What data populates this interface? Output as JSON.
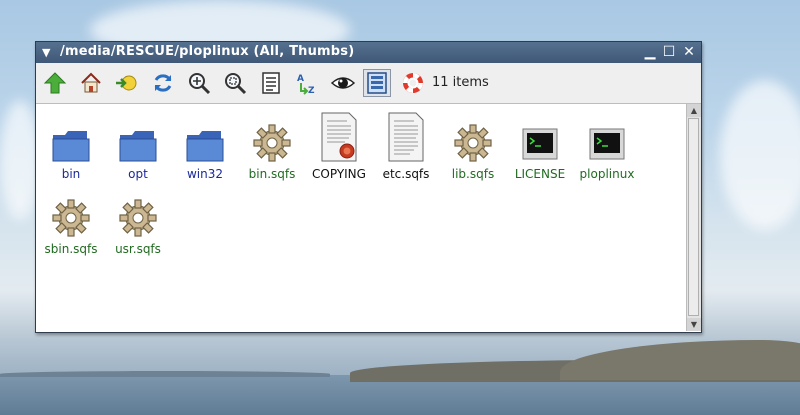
{
  "window": {
    "title": "/media/RESCUE/ploplinux (All, Thumbs)",
    "menu_glyph": "▼",
    "minimize_glyph": "▁",
    "maximize_glyph": "☐",
    "close_glyph": "✕"
  },
  "toolbar": {
    "buttons": [
      {
        "name": "up-arrow-icon"
      },
      {
        "name": "home-icon"
      },
      {
        "name": "go-to-directory-icon"
      },
      {
        "name": "refresh-icon"
      },
      {
        "name": "zoom-in-icon"
      },
      {
        "name": "zoom-fit-icon"
      },
      {
        "name": "details-view-icon"
      },
      {
        "name": "sort-az-icon"
      },
      {
        "name": "show-hidden-icon"
      },
      {
        "name": "thumbnails-view-icon"
      },
      {
        "name": "help-icon"
      }
    ],
    "item_count": "11 items"
  },
  "files": [
    {
      "label": "bin",
      "kind": "dir"
    },
    {
      "label": "opt",
      "kind": "dir"
    },
    {
      "label": "win32",
      "kind": "dir"
    },
    {
      "label": "bin.sqfs",
      "kind": "exec"
    },
    {
      "label": "COPYING",
      "kind": "doc-seal"
    },
    {
      "label": "etc.sqfs",
      "kind": "doc"
    },
    {
      "label": "lib.sqfs",
      "kind": "exec"
    },
    {
      "label": "LICENSE",
      "kind": "terminal"
    },
    {
      "label": "ploplinux",
      "kind": "terminal"
    },
    {
      "label": "sbin.sqfs",
      "kind": "exec"
    },
    {
      "label": "usr.sqfs",
      "kind": "exec"
    }
  ],
  "colors": {
    "titlebar": "#4a6484",
    "directory_label": "#1a2a9a",
    "executable_label": "#216a21"
  }
}
